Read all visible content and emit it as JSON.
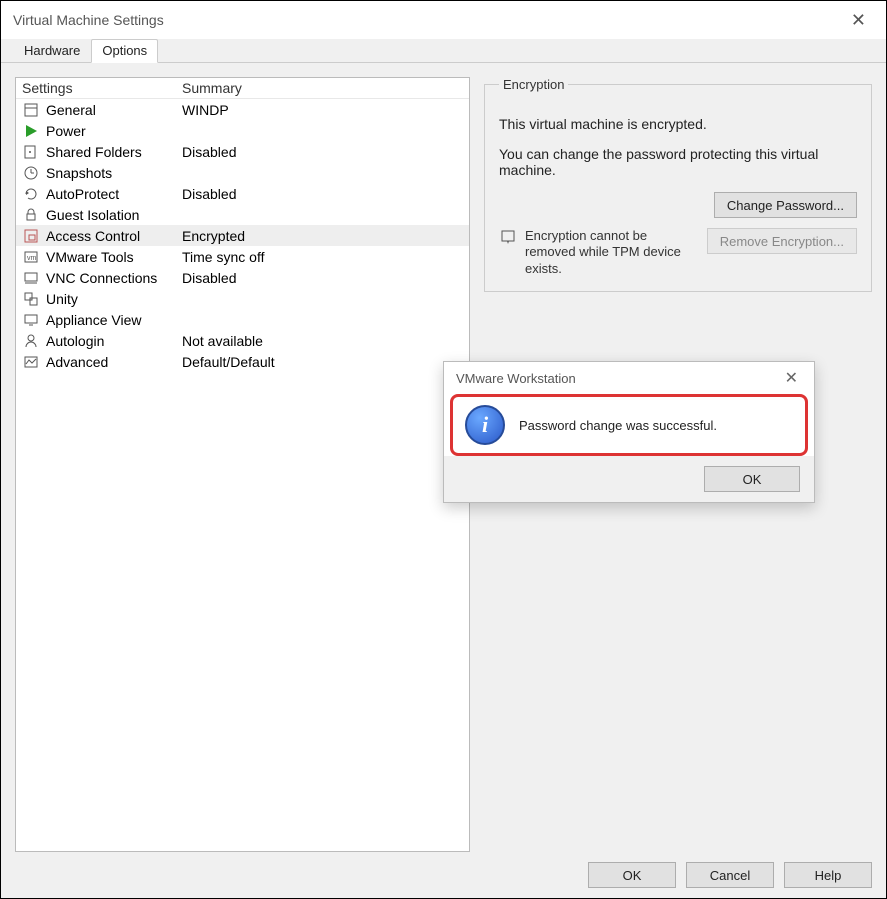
{
  "window": {
    "title": "Virtual Machine Settings"
  },
  "tabs": {
    "hardware": "Hardware",
    "options": "Options"
  },
  "list": {
    "header_settings": "Settings",
    "header_summary": "Summary",
    "rows": [
      {
        "label": "General",
        "summary": "WINDP"
      },
      {
        "label": "Power",
        "summary": ""
      },
      {
        "label": "Shared Folders",
        "summary": "Disabled"
      },
      {
        "label": "Snapshots",
        "summary": ""
      },
      {
        "label": "AutoProtect",
        "summary": "Disabled"
      },
      {
        "label": "Guest Isolation",
        "summary": ""
      },
      {
        "label": "Access Control",
        "summary": "Encrypted"
      },
      {
        "label": "VMware Tools",
        "summary": "Time sync off"
      },
      {
        "label": "VNC Connections",
        "summary": "Disabled"
      },
      {
        "label": "Unity",
        "summary": ""
      },
      {
        "label": "Appliance View",
        "summary": ""
      },
      {
        "label": "Autologin",
        "summary": "Not available"
      },
      {
        "label": "Advanced",
        "summary": "Default/Default"
      }
    ]
  },
  "encryption": {
    "group_label": "Encryption",
    "line1": "This virtual machine is encrypted.",
    "line2": "You can change the password protecting this virtual machine.",
    "change_btn": "Change Password...",
    "note": "Encryption cannot be removed while TPM device exists.",
    "remove_btn": "Remove Encryption..."
  },
  "footer": {
    "ok": "OK",
    "cancel": "Cancel",
    "help": "Help"
  },
  "dialog": {
    "title": "VMware Workstation",
    "message": "Password change was successful.",
    "ok": "OK"
  }
}
